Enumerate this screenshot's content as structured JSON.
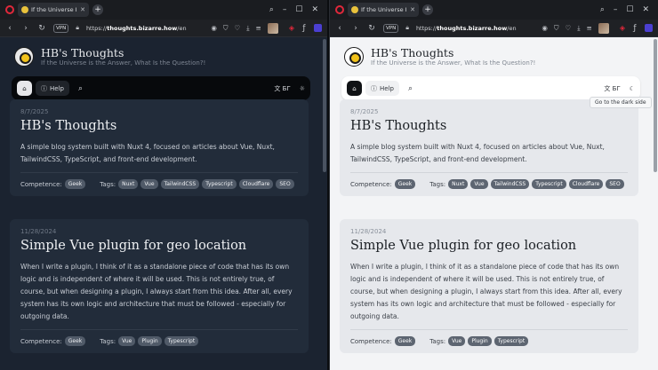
{
  "tab_title": "If the Universe Is the Ans",
  "url_host": "thoughts.bizarre.how",
  "url_prefix": "https://",
  "url_path": "/en",
  "vpn_label": "VPN",
  "site": {
    "title": "HB's Thoughts",
    "subtitle": "If the Universe is the Answer, What Is the Question?!"
  },
  "navbar": {
    "help_label": "Help",
    "lang_label": "БГ",
    "theme_tooltip": "Go to the dark side"
  },
  "posts": [
    {
      "date": "8/7/2025",
      "title": "HB's Thoughts",
      "text": "A simple blog system built with Nuxt 4, focused on articles about Vue, Nuxt, TailwindCSS, TypeScript, and front-end development.",
      "competence_label": "Competence:",
      "competence": "Geek",
      "tags_label": "Tags:",
      "tags": [
        "Nuxt",
        "Vue",
        "TailwindCSS",
        "Typescript",
        "Cloudflare",
        "SEO"
      ]
    },
    {
      "date": "11/28/2024",
      "title": "Simple Vue plugin for geo location",
      "text": "When I write a plugin, I think of it as a standalone piece of code that has its own logic and is independent of where it will be used. This is not entirely true, of course, but when designing a plugin, I always start from this idea. After all, every system has its own logic and architecture that must be followed - especially for outgoing data.",
      "competence_label": "Competence:",
      "competence": "Geek",
      "tags_label": "Tags:",
      "tags": [
        "Vue",
        "Plugin",
        "Typescript"
      ]
    }
  ],
  "colors": {
    "dark_bg": "#1b2330",
    "dark_card": "#222c3a",
    "light_bg": "#f3f4f6",
    "light_card": "#e6e8ec",
    "browser_red": "#e0283b"
  }
}
